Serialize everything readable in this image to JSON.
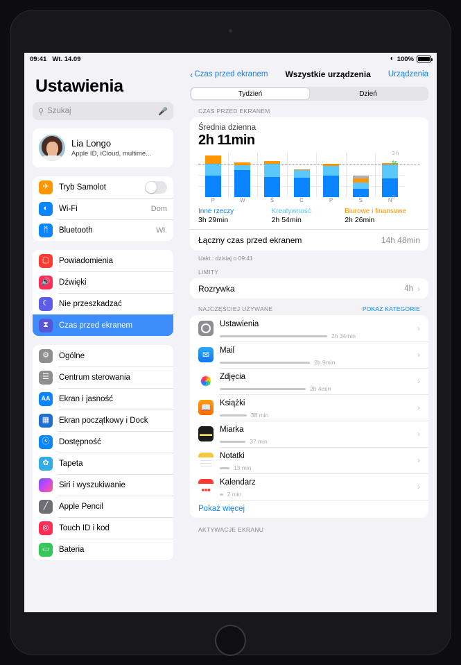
{
  "statusbar": {
    "time": "09:41",
    "date": "Wt. 14.09",
    "wifi_icon": "wifi-icon",
    "battery": "100%"
  },
  "sidebar": {
    "title": "Ustawienia",
    "search": {
      "placeholder": "Szukaj",
      "icon": "search-icon",
      "mic_icon": "microphone-icon"
    },
    "profile": {
      "name": "Lia Longo",
      "subtitle": "Apple ID, iCloud, multime..."
    },
    "groups": [
      {
        "items": [
          {
            "label": "Tryb Samolot",
            "icon": "airplane-icon",
            "color": "orange",
            "glyph": "✈",
            "control": "toggle",
            "toggle_on": false
          },
          {
            "label": "Wi-Fi",
            "icon": "wifi-icon",
            "color": "blue",
            "glyph": "◠",
            "value": "Dom"
          },
          {
            "label": "Bluetooth",
            "icon": "bluetooth-icon",
            "color": "blue",
            "glyph": "ᛗ",
            "value": "Wł."
          }
        ]
      },
      {
        "items": [
          {
            "label": "Powiadomienia",
            "icon": "notifications-icon",
            "color": "red",
            "glyph": "▢"
          },
          {
            "label": "Dźwięki",
            "icon": "sounds-icon",
            "color": "pink",
            "glyph": "ᴘ"
          },
          {
            "label": "Nie przeszkadzać",
            "icon": "moon-icon",
            "color": "purple",
            "glyph": "☾"
          },
          {
            "label": "Czas przed ekranem",
            "icon": "hourglass-icon",
            "color": "indigo",
            "glyph": "⧗",
            "selected": true
          }
        ]
      },
      {
        "items": [
          {
            "label": "Ogólne",
            "icon": "gear-icon",
            "color": "gray",
            "glyph": "⚙"
          },
          {
            "label": "Centrum sterowania",
            "icon": "control-center-icon",
            "color": "gray",
            "glyph": "☰"
          },
          {
            "label": "Ekran i jasność",
            "icon": "display-brightness-icon",
            "color": "aa",
            "glyph": "AA"
          },
          {
            "label": "Ekran początkowy i Dock",
            "icon": "home-screen-dock-icon",
            "color": "grid",
            "glyph": "▒"
          },
          {
            "label": "Dostępność",
            "icon": "accessibility-icon",
            "color": "blue",
            "glyph": "Ⓔ"
          },
          {
            "label": "Tapeta",
            "icon": "wallpaper-icon",
            "color": "cyan",
            "glyph": "✿"
          },
          {
            "label": "Siri i wyszukiwanie",
            "icon": "siri-icon",
            "color": "gradient",
            "glyph": ""
          },
          {
            "label": "Apple Pencil",
            "icon": "apple-pencil-icon",
            "color": "darkgray",
            "glyph": "╱"
          },
          {
            "label": "Touch ID i kod",
            "icon": "touch-id-icon",
            "color": "pink",
            "glyph": "◎"
          },
          {
            "label": "Bateria",
            "icon": "battery-icon",
            "color": "green",
            "glyph": "▭"
          }
        ]
      }
    ]
  },
  "detail": {
    "navbar": {
      "back_label": "Czas przed ekranem",
      "title": "Wszystkie urządzenia",
      "right_label": "Urządzenia"
    },
    "segmented": {
      "options": [
        "Tydzień",
        "Dzień"
      ],
      "selected": "Tydzień"
    },
    "screen_time": {
      "header": "CZAS PRZED EKRANEM",
      "average_label": "Średnia dzienna",
      "average_value": "2h 11min",
      "total_label": "Łączny czas przed ekranem",
      "total_value": "14h 48min",
      "updated": "Uakt.: dzisiaj o 09:41",
      "legend": [
        {
          "name": "Inne rzeczy",
          "time": "3h 29min",
          "color": "#0a84ff"
        },
        {
          "name": "Kreatywność",
          "time": "2h 54min",
          "color": "#5ac8fa"
        },
        {
          "name": "Biurowe i finansowe",
          "time": "2h 26min",
          "color": "#ff9500"
        }
      ]
    },
    "limits": {
      "header": "LIMITY",
      "items": [
        {
          "label": "Rozrywka",
          "value": "4h"
        }
      ]
    },
    "most_used": {
      "header": "NAJCZĘŚCIEJ UŻYWANE",
      "action_label": "POKAŻ KATEGORIE",
      "apps": [
        {
          "name": "Ustawienia",
          "time": "2h 34min",
          "bar_pct": 100,
          "icon": "settings-app-icon"
        },
        {
          "name": "Mail",
          "time": "2h 9min",
          "bar_pct": 84,
          "icon": "mail-app-icon"
        },
        {
          "name": "Zdjęcia",
          "time": "2h 4min",
          "bar_pct": 80,
          "icon": "photos-app-icon"
        },
        {
          "name": "Książki",
          "time": "38 min",
          "bar_pct": 25,
          "icon": "books-app-icon"
        },
        {
          "name": "Miarka",
          "time": "37 min",
          "bar_pct": 24,
          "icon": "measure-app-icon"
        },
        {
          "name": "Notatki",
          "time": "13 min",
          "bar_pct": 9,
          "icon": "notes-app-icon"
        },
        {
          "name": "Kalendarz",
          "time": "2 min",
          "bar_pct": 3,
          "icon": "calendar-app-icon"
        }
      ],
      "show_more_label": "Pokaż więcej"
    },
    "pickups": {
      "header": "AKTYWACJE EKRANU"
    }
  },
  "chart_data": {
    "type": "bar",
    "stacked": true,
    "title": "Średnia dzienna — czas przed ekranem",
    "categories": [
      "P",
      "W",
      "Ś",
      "C",
      "P",
      "S",
      "N"
    ],
    "xlabel": "",
    "ylabel": "",
    "ylim": [
      0,
      3
    ],
    "yunit": "h",
    "ticks": [
      {
        "value": 3,
        "label": "3 h"
      },
      {
        "value": 0,
        "label": "0"
      }
    ],
    "average_line": {
      "value": 2.183,
      "label": "śr.",
      "color": "#30c94e",
      "style": "dotted"
    },
    "grid": true,
    "legend_position": "below",
    "series": [
      {
        "name": "Inne rzeczy",
        "color": "#0a84ff",
        "values": [
          1.45,
          1.85,
          1.35,
          1.3,
          1.45,
          0.55,
          1.25
        ]
      },
      {
        "name": "Kreatywność",
        "color": "#5ac8fa",
        "values": [
          0.8,
          0.3,
          0.9,
          0.55,
          0.65,
          0.45,
          0.95
        ]
      },
      {
        "name": "Biurowe i finansowe",
        "color": "#ff9500",
        "values": [
          0.55,
          0.2,
          0.2,
          0.05,
          0.15,
          0.25,
          0.12
        ]
      },
      {
        "name": "Inne",
        "color": "#b0b0b5",
        "values": [
          0,
          0,
          0,
          0,
          0,
          0.22,
          0
        ]
      }
    ],
    "totals": [
      2.8,
      2.35,
      2.45,
      1.9,
      2.25,
      1.47,
      2.32
    ]
  }
}
